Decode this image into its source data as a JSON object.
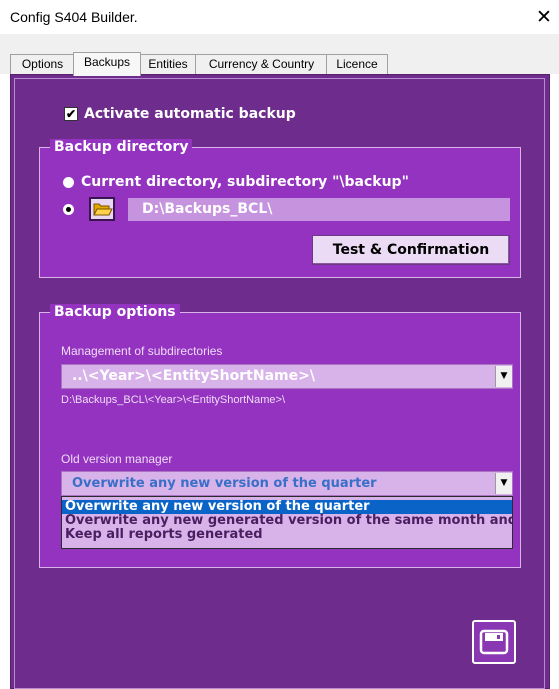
{
  "window": {
    "title": "Config S404 Builder.",
    "close_glyph": "✕"
  },
  "tabs": [
    {
      "label": "Options",
      "active": false
    },
    {
      "label": "Backups",
      "active": true
    },
    {
      "label": "Entities",
      "active": false
    },
    {
      "label": "Currency & Country",
      "active": false
    },
    {
      "label": "Licence",
      "active": false
    }
  ],
  "backup": {
    "activate_label": "Activate automatic backup",
    "activate_checked": true,
    "check_glyph": "✔"
  },
  "directory": {
    "group_title": "Backup directory",
    "option_current_label": "Current directory, subdirectory \"\\backup\"",
    "option_custom_selected": true,
    "path_value": "D:\\Backups_BCL\\",
    "folder_icon": "open-folder-icon",
    "test_button_label": "Test & Confirmation"
  },
  "options": {
    "group_title": "Backup options",
    "subdir_label": "Management of subdirectories",
    "subdir_value": "..\\<Year>\\<EntityShortName>\\",
    "subdir_preview": "D:\\Backups_BCL\\<Year>\\<EntityShortName>\\",
    "oldver_label": "Old version manager",
    "oldver_value": "Overwrite any new version of the quarter",
    "oldver_options": [
      "Overwrite any new version of the quarter",
      "Overwrite any new generated version of the same month and",
      "Keep all reports generated"
    ],
    "oldver_selected_index": 0,
    "dropdown_glyph": "▼"
  },
  "save": {
    "icon": "floppy-disk-icon"
  },
  "colors": {
    "panel": "#6e2c8c",
    "group": "#9333c0",
    "field": "#c693de",
    "combo": "#d8b3ea",
    "selection": "#0a64c8"
  }
}
